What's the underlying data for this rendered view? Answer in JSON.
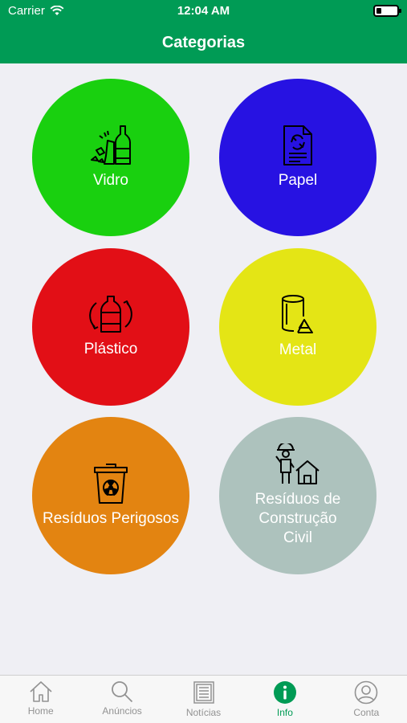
{
  "status_bar": {
    "carrier": "Carrier",
    "time": "12:04 AM"
  },
  "nav": {
    "title": "Categorias"
  },
  "categories": [
    {
      "label": "Vidro",
      "color": "#19d00f",
      "icon": "glass-bottle-icon"
    },
    {
      "label": "Papel",
      "color": "#2712e2",
      "icon": "paper-recycle-icon"
    },
    {
      "label": "Plástico",
      "color": "#e20f16",
      "icon": "plastic-bottle-icon"
    },
    {
      "label": "Metal",
      "color": "#e4e515",
      "icon": "metal-can-icon"
    },
    {
      "label": "Resíduos Perigosos",
      "color": "#e38411",
      "icon": "hazardous-bin-icon"
    },
    {
      "label": "Resíduos de Construção Civil",
      "color": "#adc2bd",
      "icon": "construction-worker-icon"
    }
  ],
  "tabs": [
    {
      "label": "Home",
      "icon": "home-icon"
    },
    {
      "label": "Anúncios",
      "icon": "search-icon"
    },
    {
      "label": "Notícias",
      "icon": "news-icon"
    },
    {
      "label": "Info",
      "icon": "info-icon",
      "active": true
    },
    {
      "label": "Conta",
      "icon": "account-icon"
    }
  ],
  "colors": {
    "brand": "#009b55",
    "background": "#efeff4",
    "tab_inactive": "#929292"
  }
}
